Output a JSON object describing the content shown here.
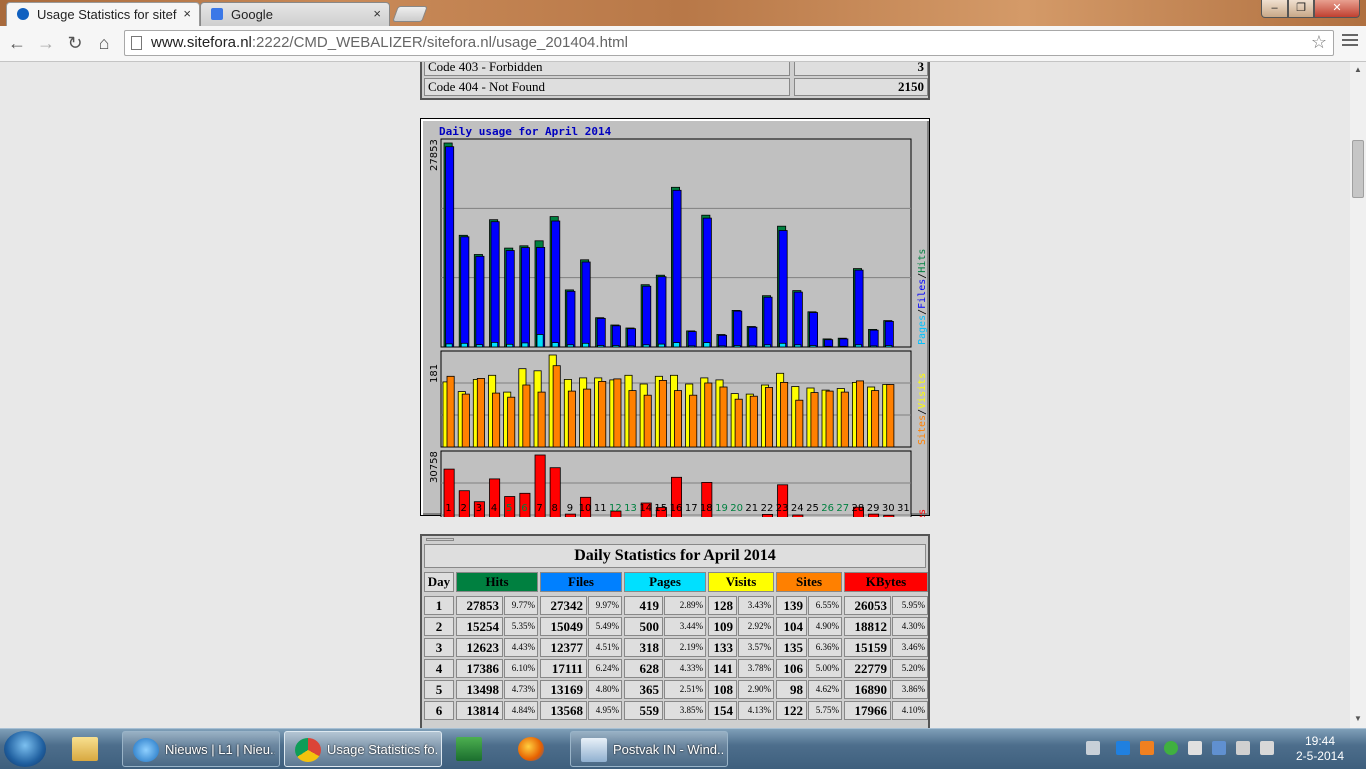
{
  "browser": {
    "tabs": [
      {
        "title": "Usage Statistics for sitefora",
        "close": "×"
      },
      {
        "title": "Google",
        "close": "×"
      }
    ],
    "url_host": "www.sitefora.nl",
    "url_rest": ":2222/CMD_WEBALIZER/sitefora.nl/usage_201404.html",
    "window_buttons": {
      "min": "‒",
      "max": "❐",
      "close": "✕"
    },
    "nav": {
      "back": "←",
      "forward": "→",
      "reload": "↻",
      "home": "⌂"
    },
    "star": "☆"
  },
  "response_codes": [
    {
      "label": "Code 403 - Forbidden",
      "value": "3"
    },
    {
      "label": "Code 404 - Not Found",
      "value": "2150"
    }
  ],
  "chart_data": {
    "type": "bar",
    "title": "Daily usage for April 2014",
    "days": [
      "1",
      "2",
      "3",
      "4",
      "5",
      "6",
      "7",
      "8",
      "9",
      "10",
      "11",
      "12",
      "13",
      "14",
      "15",
      "16",
      "17",
      "18",
      "19",
      "20",
      "21",
      "22",
      "23",
      "24",
      "25",
      "26",
      "27",
      "28",
      "29",
      "30",
      "31"
    ],
    "weekend_days": [
      "5",
      "6",
      "12",
      "13",
      "19",
      "20",
      "26",
      "27"
    ],
    "panels": [
      {
        "max_label": "27853",
        "ymax": 27853,
        "legend": [
          "Pages",
          "/",
          "Files",
          "/",
          "Hits"
        ],
        "series": [
          {
            "name": "Hits",
            "color": "#008040",
            "values": [
              27853,
              15254,
              12623,
              17386,
              13498,
              13814,
              14500,
              17800,
              7800,
              11900,
              4000,
              3000,
              2600,
              8500,
              9800,
              21800,
              2200,
              18000,
              1700,
              5000,
              2800,
              7000,
              16500,
              7700,
              4800,
              1100,
              1200,
              10700,
              2400,
              3600,
              0
            ]
          },
          {
            "name": "Files",
            "color": "#0000ff",
            "values": [
              27342,
              15049,
              12377,
              17111,
              13169,
              13568,
              13600,
              17200,
              7600,
              11600,
              3900,
              2900,
              2500,
              8300,
              9600,
              21400,
              2100,
              17600,
              1600,
              4900,
              2700,
              6800,
              15900,
              7500,
              4700,
              1000,
              1100,
              10500,
              2300,
              3500,
              0
            ]
          },
          {
            "name": "Pages",
            "color": "#00e0ff",
            "values": [
              419,
              500,
              318,
              628,
              365,
              559,
              1700,
              600,
              300,
              500,
              200,
              200,
              150,
              300,
              400,
              600,
              150,
              600,
              150,
              200,
              150,
              300,
              500,
              300,
              200,
              100,
              100,
              300,
              150,
              200,
              0
            ]
          }
        ]
      },
      {
        "max_label": "181",
        "ymax": 181,
        "legend": [
          "Sites",
          "/",
          "Visits"
        ],
        "series": [
          {
            "name": "Visits",
            "color": "#ffff00",
            "values": [
              128,
              109,
              133,
              141,
              108,
              154,
              150,
              181,
              133,
              136,
              136,
              132,
              141,
              124,
              139,
              141,
              124,
              136,
              132,
              105,
              104,
              122,
              145,
              119,
              116,
              112,
              115,
              127,
              118,
              123,
              0
            ]
          },
          {
            "name": "Sites",
            "color": "#ff8000",
            "values": [
              139,
              104,
              135,
              106,
              98,
              122,
              108,
              160,
              110,
              114,
              129,
              134,
              111,
              102,
              131,
              111,
              102,
              126,
              118,
              94,
              100,
              117,
              127,
              92,
              107,
              110,
              108,
              130,
              111,
              123,
              0
            ]
          }
        ]
      },
      {
        "max_label": "30758",
        "ymax": 30758,
        "legend": [
          "KBytes"
        ],
        "series": [
          {
            "name": "KBytes",
            "color": "#ff0000",
            "values": [
              26053,
              18812,
              15159,
              22779,
              16890,
              17966,
              30758,
              26500,
              11000,
              16600,
              8200,
              12000,
              8200,
              14700,
              13200,
              23300,
              7200,
              21600,
              8900,
              7800,
              8800,
              10900,
              20800,
              10700,
              8400,
              8600,
              7700,
              13300,
              11000,
              10600,
              0
            ]
          }
        ]
      }
    ]
  },
  "daily": {
    "title": "Daily Statistics for April 2014",
    "headers": {
      "day": "Day",
      "hits": "Hits",
      "files": "Files",
      "pages": "Pages",
      "visits": "Visits",
      "sites": "Sites",
      "kbytes": "KBytes"
    },
    "header_colors": {
      "hits": "#008040",
      "files": "#0080ff",
      "pages": "#00e0ff",
      "visits": "#ffff00",
      "sites": "#ff8000",
      "kbytes": "#ff0000"
    },
    "rows": [
      {
        "day": "1",
        "hits": "27853",
        "hits_pct": "9.77%",
        "files": "27342",
        "files_pct": "9.97%",
        "pages": "419",
        "pages_pct": "2.89%",
        "visits": "128",
        "visits_pct": "3.43%",
        "sites": "139",
        "sites_pct": "6.55%",
        "kbytes": "26053",
        "kbytes_pct": "5.95%"
      },
      {
        "day": "2",
        "hits": "15254",
        "hits_pct": "5.35%",
        "files": "15049",
        "files_pct": "5.49%",
        "pages": "500",
        "pages_pct": "3.44%",
        "visits": "109",
        "visits_pct": "2.92%",
        "sites": "104",
        "sites_pct": "4.90%",
        "kbytes": "18812",
        "kbytes_pct": "4.30%"
      },
      {
        "day": "3",
        "hits": "12623",
        "hits_pct": "4.43%",
        "files": "12377",
        "files_pct": "4.51%",
        "pages": "318",
        "pages_pct": "2.19%",
        "visits": "133",
        "visits_pct": "3.57%",
        "sites": "135",
        "sites_pct": "6.36%",
        "kbytes": "15159",
        "kbytes_pct": "3.46%"
      },
      {
        "day": "4",
        "hits": "17386",
        "hits_pct": "6.10%",
        "files": "17111",
        "files_pct": "6.24%",
        "pages": "628",
        "pages_pct": "4.33%",
        "visits": "141",
        "visits_pct": "3.78%",
        "sites": "106",
        "sites_pct": "5.00%",
        "kbytes": "22779",
        "kbytes_pct": "5.20%"
      },
      {
        "day": "5",
        "hits": "13498",
        "hits_pct": "4.73%",
        "files": "13169",
        "files_pct": "4.80%",
        "pages": "365",
        "pages_pct": "2.51%",
        "visits": "108",
        "visits_pct": "2.90%",
        "sites": "98",
        "sites_pct": "4.62%",
        "kbytes": "16890",
        "kbytes_pct": "3.86%"
      },
      {
        "day": "6",
        "hits": "13814",
        "hits_pct": "4.84%",
        "files": "13568",
        "files_pct": "4.95%",
        "pages": "559",
        "pages_pct": "3.85%",
        "visits": "154",
        "visits_pct": "4.13%",
        "sites": "122",
        "sites_pct": "5.75%",
        "kbytes": "17966",
        "kbytes_pct": "4.10%"
      }
    ]
  },
  "taskbar": {
    "windows": [
      {
        "label": "Nieuws | L1 | Nieu..."
      },
      {
        "label": "Usage Statistics fo..."
      },
      {
        "label": "Postvak IN - Wind..."
      }
    ],
    "clock_time": "19:44",
    "clock_date": "2-5-2014"
  }
}
